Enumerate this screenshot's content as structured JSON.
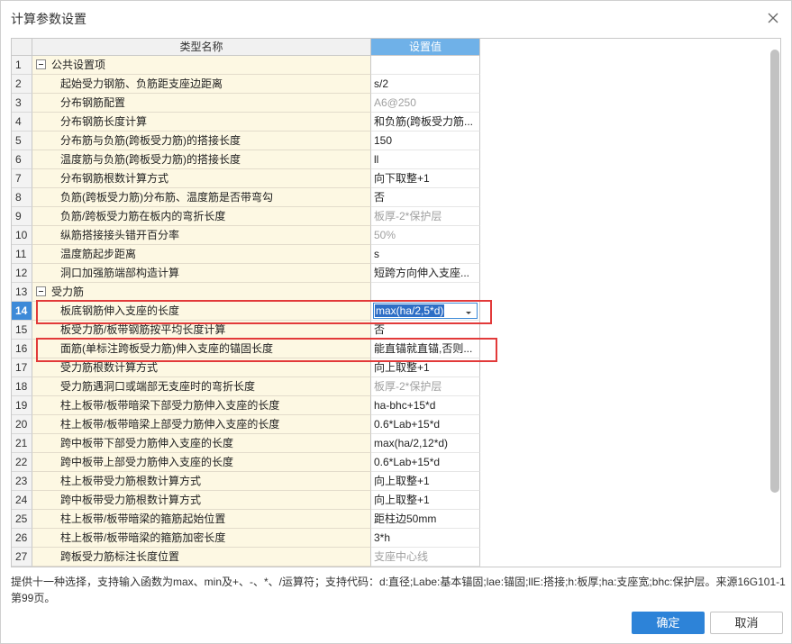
{
  "window": {
    "title": "计算参数设置"
  },
  "grid": {
    "headers": {
      "name": "类型名称",
      "value": "设置值"
    },
    "selected_index": 13,
    "rows": [
      {
        "n": "1",
        "name": "公共设置项",
        "value": "",
        "type": "group"
      },
      {
        "n": "2",
        "name": "起始受力钢筋、负筋距支座边距离",
        "value": "s/2",
        "type": "item"
      },
      {
        "n": "3",
        "name": "分布钢筋配置",
        "value": "A6@250",
        "type": "item",
        "gray": true
      },
      {
        "n": "4",
        "name": "分布钢筋长度计算",
        "value": "和负筋(跨板受力筋...",
        "type": "item"
      },
      {
        "n": "5",
        "name": "分布筋与负筋(跨板受力筋)的搭接长度",
        "value": "150",
        "type": "item"
      },
      {
        "n": "6",
        "name": "温度筋与负筋(跨板受力筋)的搭接长度",
        "value": "ll",
        "type": "item"
      },
      {
        "n": "7",
        "name": "分布钢筋根数计算方式",
        "value": "向下取整+1",
        "type": "item"
      },
      {
        "n": "8",
        "name": "负筋(跨板受力筋)分布筋、温度筋是否带弯勾",
        "value": "否",
        "type": "item"
      },
      {
        "n": "9",
        "name": "负筋/跨板受力筋在板内的弯折长度",
        "value": "板厚-2*保护层",
        "type": "item",
        "gray": true
      },
      {
        "n": "10",
        "name": "纵筋搭接接头错开百分率",
        "value": "50%",
        "type": "item",
        "gray": true
      },
      {
        "n": "11",
        "name": "温度筋起步距离",
        "value": "s",
        "type": "item"
      },
      {
        "n": "12",
        "name": "洞口加强筋端部构造计算",
        "value": "短跨方向伸入支座...",
        "type": "item"
      },
      {
        "n": "13",
        "name": "受力筋",
        "value": "",
        "type": "group"
      },
      {
        "n": "14",
        "name": "板底钢筋伸入支座的长度",
        "value": "max(ha/2,5*d)",
        "type": "item"
      },
      {
        "n": "15",
        "name": "板受力筋/板带钢筋按平均长度计算",
        "value": "否",
        "type": "item"
      },
      {
        "n": "16",
        "name": "面筋(单标注跨板受力筋)伸入支座的锚固长度",
        "value": "能直锚就直锚,否则...",
        "type": "item"
      },
      {
        "n": "17",
        "name": "受力筋根数计算方式",
        "value": "向上取整+1",
        "type": "item"
      },
      {
        "n": "18",
        "name": "受力筋遇洞口或端部无支座时的弯折长度",
        "value": "板厚-2*保护层",
        "type": "item",
        "gray": true
      },
      {
        "n": "19",
        "name": "柱上板带/板带暗梁下部受力筋伸入支座的长度",
        "value": "ha-bhc+15*d",
        "type": "item"
      },
      {
        "n": "20",
        "name": "柱上板带/板带暗梁上部受力筋伸入支座的长度",
        "value": "0.6*Lab+15*d",
        "type": "item"
      },
      {
        "n": "21",
        "name": "跨中板带下部受力筋伸入支座的长度",
        "value": "max(ha/2,12*d)",
        "type": "item"
      },
      {
        "n": "22",
        "name": "跨中板带上部受力筋伸入支座的长度",
        "value": "0.6*Lab+15*d",
        "type": "item"
      },
      {
        "n": "23",
        "name": "柱上板带受力筋根数计算方式",
        "value": "向上取整+1",
        "type": "item"
      },
      {
        "n": "24",
        "name": "跨中板带受力筋根数计算方式",
        "value": "向上取整+1",
        "type": "item"
      },
      {
        "n": "25",
        "name": "柱上板带/板带暗梁的箍筋起始位置",
        "value": "距柱边50mm",
        "type": "item"
      },
      {
        "n": "26",
        "name": "柱上板带/板带暗梁的箍筋加密长度",
        "value": "3*h",
        "type": "item"
      },
      {
        "n": "27",
        "name": "跨板受力筋标注长度位置",
        "value": "支座中心线",
        "type": "item",
        "gray": true
      }
    ]
  },
  "help_text": "提供十一种选择，支持输入函数为max、min及+、-、*、/运算符；支持代码：d:直径;Labe:基本锚固;lae:锚固;llE:搭接;h:板厚;ha:支座宽;bhc:保护层。来源16G101-1第99页。",
  "buttons": {
    "ok": "确定",
    "cancel": "取消"
  },
  "colors": {
    "accent": "#2d83d8",
    "highlight": "#e23a3a",
    "name_cell_bg": "#fdf8e3"
  }
}
